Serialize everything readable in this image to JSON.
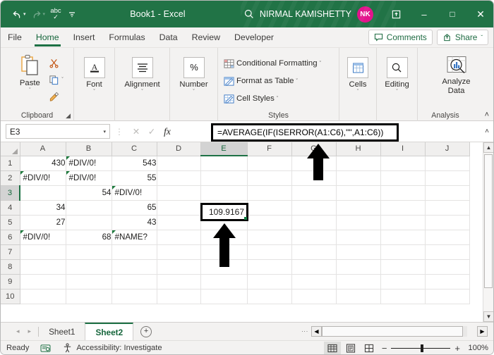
{
  "titlebar": {
    "undo": "undo-arrow",
    "redo": "redo-arrow",
    "spelling": "abc",
    "qat_more": "customize-quick-access",
    "title": "Book1 - Excel",
    "search": "search-icon",
    "account_name": "NIRMAL KAMISHETTY",
    "avatar_initials": "NK",
    "ribbon_display": "ribbon-display-options",
    "minimize": "–",
    "maximize": "□",
    "close": "✕",
    "accent_color": "#217346",
    "avatar_color": "#e3148c"
  },
  "tabs": [
    {
      "label": "File",
      "active": false
    },
    {
      "label": "Home",
      "active": true
    },
    {
      "label": "Insert",
      "active": false
    },
    {
      "label": "Formulas",
      "active": false
    },
    {
      "label": "Data",
      "active": false
    },
    {
      "label": "Review",
      "active": false
    },
    {
      "label": "Developer",
      "active": false
    }
  ],
  "tab_right": {
    "comments": "Comments",
    "share": "Share",
    "share_caret": "ˇ"
  },
  "ribbon": {
    "groups": [
      {
        "name": "Clipboard",
        "label": "Clipboard",
        "has_launcher": true
      },
      {
        "name": "Font",
        "label": ""
      },
      {
        "name": "Alignment",
        "label": ""
      },
      {
        "name": "Number",
        "label": ""
      },
      {
        "name": "Styles",
        "label": "Styles"
      },
      {
        "name": "Cells",
        "label": ""
      },
      {
        "name": "Editing",
        "label": ""
      },
      {
        "name": "Analysis",
        "label": "Analysis"
      }
    ],
    "paste": "Paste",
    "cut": "scissors-icon",
    "copy": "copy-icon",
    "format_painter": "format-painter-icon",
    "font": "Font",
    "alignment": "Alignment",
    "number": "Number",
    "conditional_formatting": "Conditional Formatting",
    "format_as_table": "Format as Table",
    "cell_styles": "Cell Styles",
    "cells": "Cells",
    "editing": "Editing",
    "analyze_data_line1": "Analyze",
    "analyze_data_line2": "Data",
    "dropdown_caret": "ˇ",
    "collapse_ribbon": "˄"
  },
  "formula_bar": {
    "name_box": "E3",
    "cancel": "✕",
    "enter": "✓",
    "insert_function": "fx",
    "formula": "=AVERAGE(IF(ISERROR(A1:C6),\"\",A1:C6))",
    "expand": "˄"
  },
  "grid": {
    "columns": [
      "A",
      "B",
      "C",
      "D",
      "E",
      "F",
      "G",
      "H",
      "I",
      "J"
    ],
    "selected_column": "E",
    "rows": [
      "1",
      "2",
      "3",
      "4",
      "5",
      "6",
      "7",
      "8",
      "9",
      "10"
    ],
    "selected_row": "3",
    "cells": [
      [
        {
          "v": "430",
          "t": "num"
        },
        {
          "v": "#DIV/0!",
          "t": "err"
        },
        {
          "v": "543",
          "t": "num"
        }
      ],
      [
        {
          "v": "#DIV/0!",
          "t": "err"
        },
        {
          "v": "#DIV/0!",
          "t": "err"
        },
        {
          "v": "55",
          "t": "num"
        }
      ],
      [
        {
          "v": "",
          "t": "num"
        },
        {
          "v": "54",
          "t": "num"
        },
        {
          "v": "#DIV/0!",
          "t": "err"
        }
      ],
      [
        {
          "v": "34",
          "t": "num"
        },
        {
          "v": "",
          "t": "num"
        },
        {
          "v": "65",
          "t": "num"
        }
      ],
      [
        {
          "v": "27",
          "t": "num"
        },
        {
          "v": "",
          "t": "num"
        },
        {
          "v": "43",
          "t": "num"
        }
      ],
      [
        {
          "v": "#DIV/0!",
          "t": "err"
        },
        {
          "v": "68",
          "t": "num"
        },
        {
          "v": "#NAME?",
          "t": "err"
        }
      ]
    ],
    "result_cell_ref": "E3",
    "result_value": "109.9167"
  },
  "sheet_tabs": {
    "first": "◂",
    "prev": "▸",
    "sheets": [
      {
        "label": "Sheet1",
        "active": false
      },
      {
        "label": "Sheet2",
        "active": true
      }
    ],
    "add": "+"
  },
  "status_bar": {
    "mode": "Ready",
    "recording_icon": "macro-record-icon",
    "accessibility_icon": "accessibility-icon",
    "accessibility": "Accessibility: Investigate",
    "view_normal": "normal-view-icon",
    "view_page_layout": "page-layout-view-icon",
    "view_page_break": "page-break-view-icon",
    "zoom_out": "−",
    "zoom_in": "+",
    "zoom_level": "100%"
  }
}
